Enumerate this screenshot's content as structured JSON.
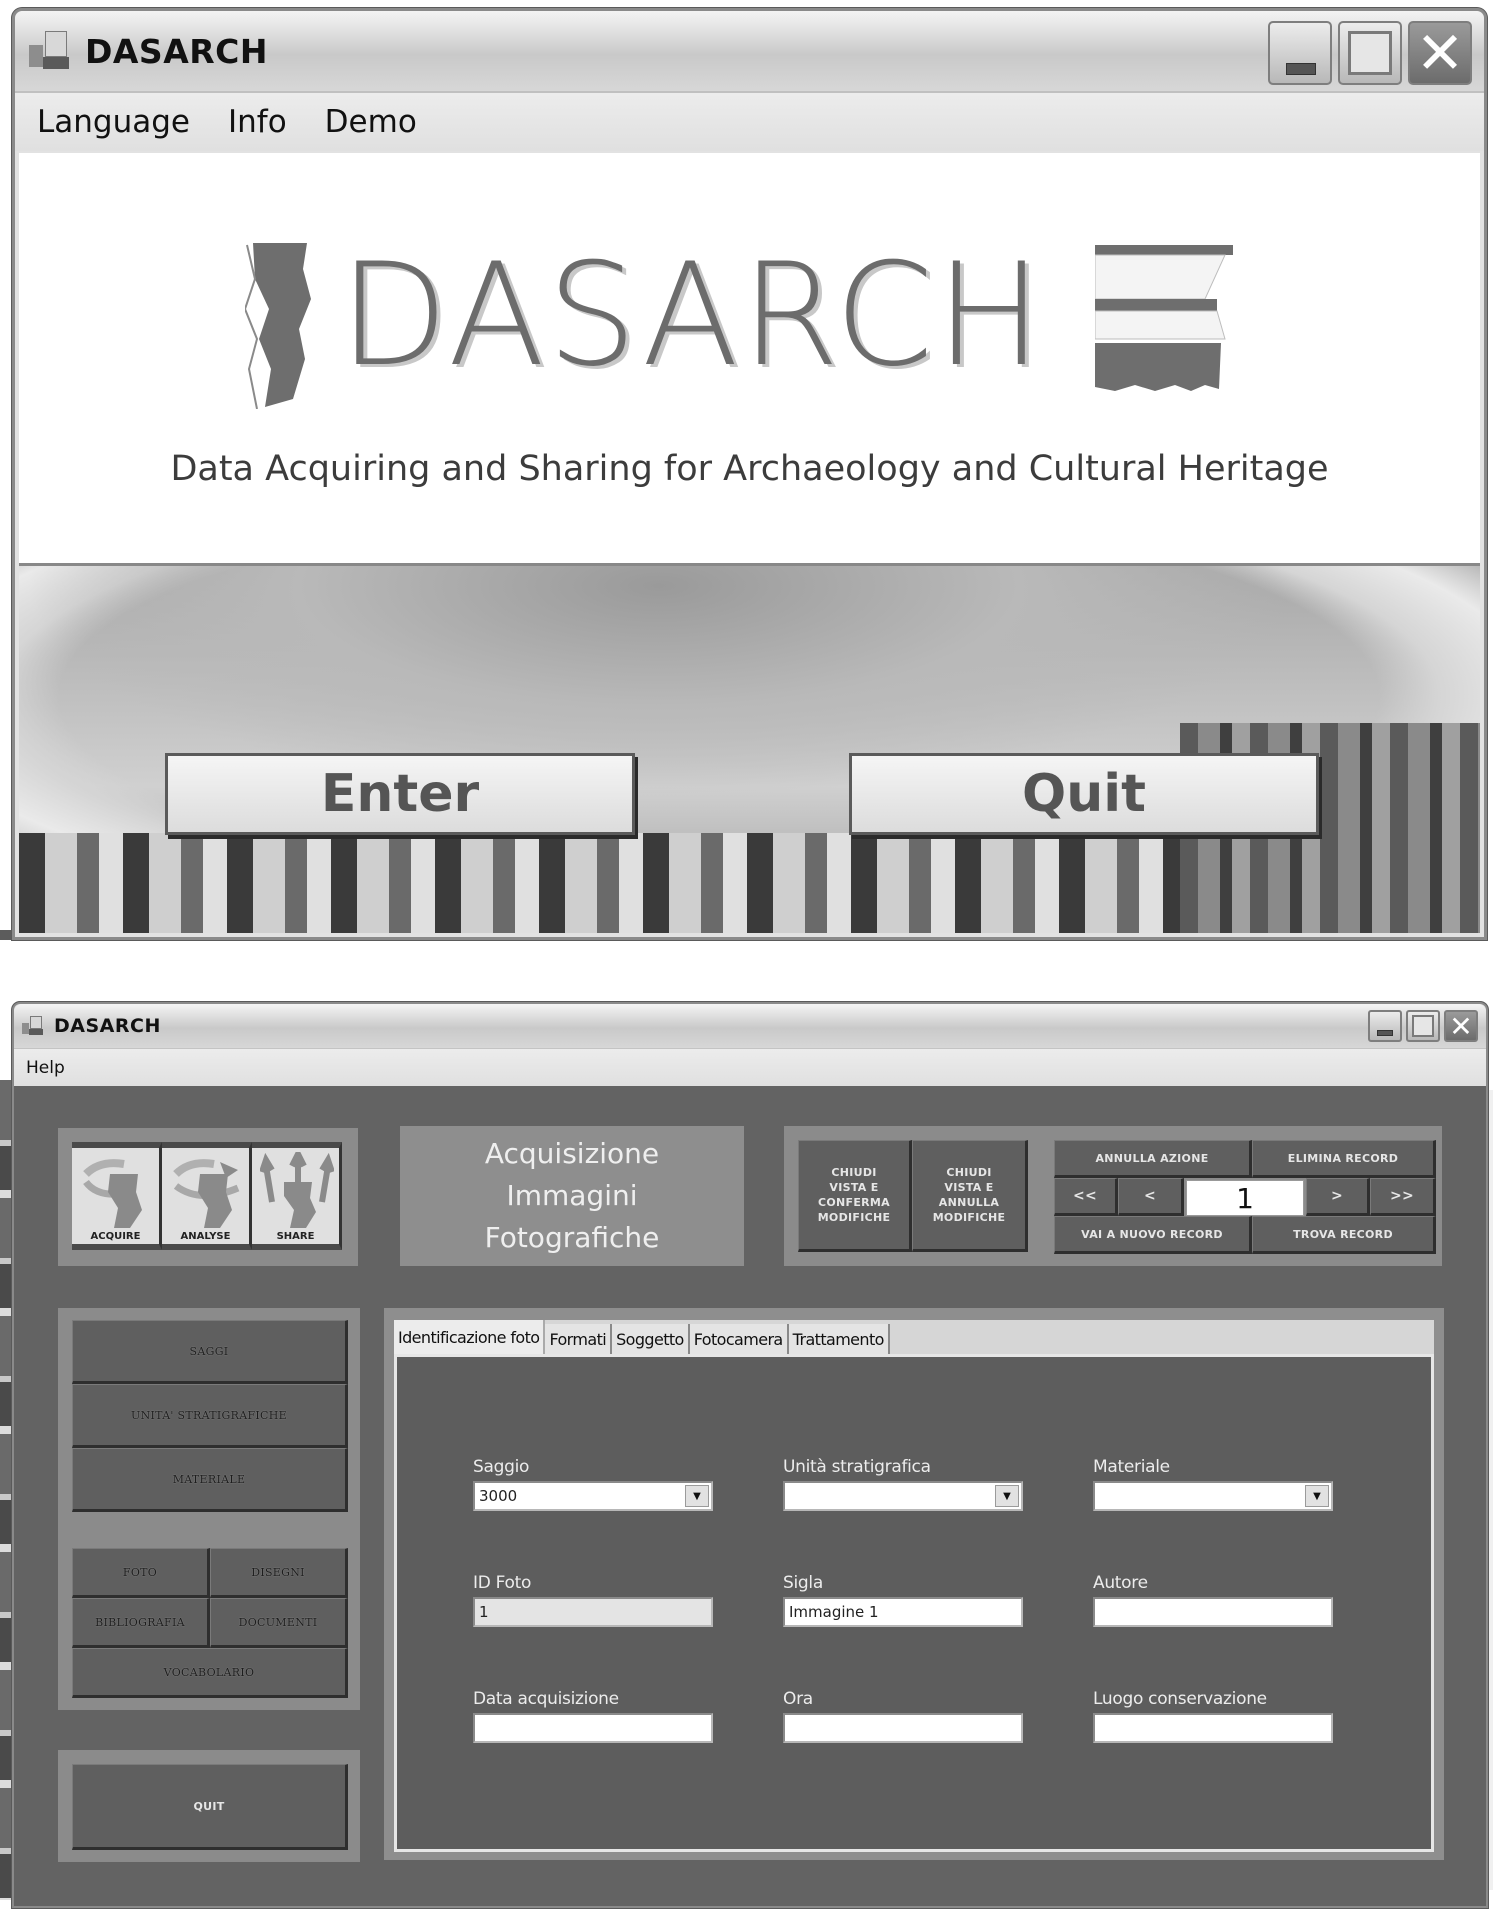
{
  "splash_window": {
    "title": "DASARCH",
    "menu": [
      "Language",
      "Info",
      "Demo"
    ],
    "logo_text": "DASARCH",
    "tagline": "Data Acquiring and Sharing for Archaeology and Cultural Heritage",
    "buttons": {
      "enter": "Enter",
      "quit": "Quit"
    }
  },
  "main_window": {
    "title": "DASARCH",
    "menu": [
      "Help"
    ],
    "modules": [
      {
        "label": "ACQUIRE",
        "icon": "acquire-icon"
      },
      {
        "label": "ANALYSE",
        "icon": "analyse-icon"
      },
      {
        "label": "SHARE",
        "icon": "share-icon"
      }
    ],
    "form_title": [
      "Acquisizione",
      "Immagini",
      "Fotografiche"
    ],
    "actions": {
      "close_confirm": [
        "CHIUDI",
        "VISTA E",
        "CONFERMA",
        "MODIFICHE"
      ],
      "close_cancel": [
        "CHIUDI",
        "VISTA E",
        "ANNULLA",
        "MODIFICHE"
      ],
      "undo": "ANNULLA AZIONE",
      "delete": "ELIMINA RECORD",
      "first": "<<",
      "prev": "<",
      "record_number": "1",
      "next": ">",
      "last": ">>",
      "new_record": "VAI A NUOVO RECORD",
      "find_record": "TROVA RECORD"
    },
    "nav": {
      "saggi": "SAGGI",
      "unita": "UNITA' STRATIGRAFICHE",
      "materiale": "MATERIALE",
      "foto": "FOTO",
      "disegni": "DISEGNI",
      "bibliografia": "BIBLIOGRAFIA",
      "documenti": "DOCUMENTI",
      "vocabolario": "VOCABOLARIO",
      "quit": "QUIT"
    },
    "tabs": [
      "Identificazione foto",
      "Formati",
      "Soggetto",
      "Fotocamera",
      "Trattamento"
    ],
    "active_tab": "Identificazione foto",
    "fields": {
      "saggio": {
        "label": "Saggio",
        "value": "3000"
      },
      "unita_stratigrafica": {
        "label": "Unità stratigrafica",
        "value": ""
      },
      "materiale": {
        "label": "Materiale",
        "value": ""
      },
      "id_foto": {
        "label": "ID Foto",
        "value": "1"
      },
      "sigla": {
        "label": "Sigla",
        "value": "Immagine 1"
      },
      "autore": {
        "label": "Autore",
        "value": ""
      },
      "data_acquisizione": {
        "label": "Data acquisizione",
        "value": ""
      },
      "ora": {
        "label": "Ora",
        "value": ""
      },
      "luogo_conservazione": {
        "label": "Luogo conservazione",
        "value": ""
      }
    },
    "dropdown_glyph": "▼"
  }
}
